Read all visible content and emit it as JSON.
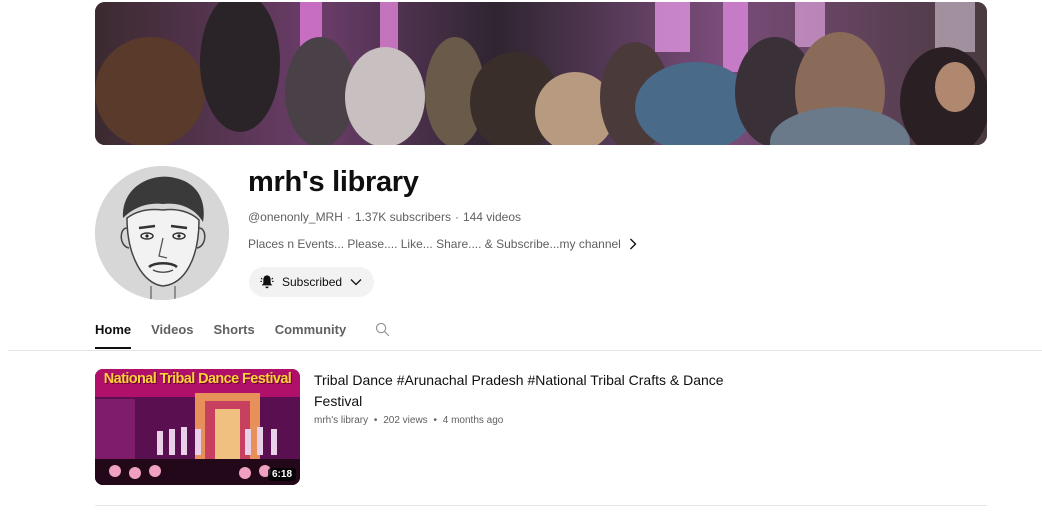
{
  "channel": {
    "name": "mrh's library",
    "handle": "@onenonly_MRH",
    "subscribers": "1.37K subscribers",
    "videos": "144 videos",
    "separator": "·",
    "description": "Places n Events... Please.... Like... Share.... & Subscribe...my channel",
    "subscribe_label": "Subscribed"
  },
  "icons": {
    "description_expand": "chevron-right-icon",
    "bell": "bell-icon",
    "subscribe_dropdown": "chevron-down-icon",
    "search": "search-icon"
  },
  "tabs": [
    {
      "label": "Home",
      "active": true
    },
    {
      "label": "Videos",
      "active": false
    },
    {
      "label": "Shorts",
      "active": false
    },
    {
      "label": "Community",
      "active": false
    }
  ],
  "videos": [
    {
      "thumbnail_title": "National Tribal Dance Festival",
      "duration": "6:18",
      "title": "Tribal Dance #Arunachal Pradesh #National Tribal Crafts & Dance Festival",
      "channel": "mrh's library",
      "views": "202 views",
      "age": "4 months ago",
      "dot": "•"
    }
  ],
  "colors": {
    "text_primary": "#0f0f0f",
    "text_secondary": "#606060",
    "button_bg": "#f2f2f2",
    "thumb_title": "#ffd23a"
  }
}
